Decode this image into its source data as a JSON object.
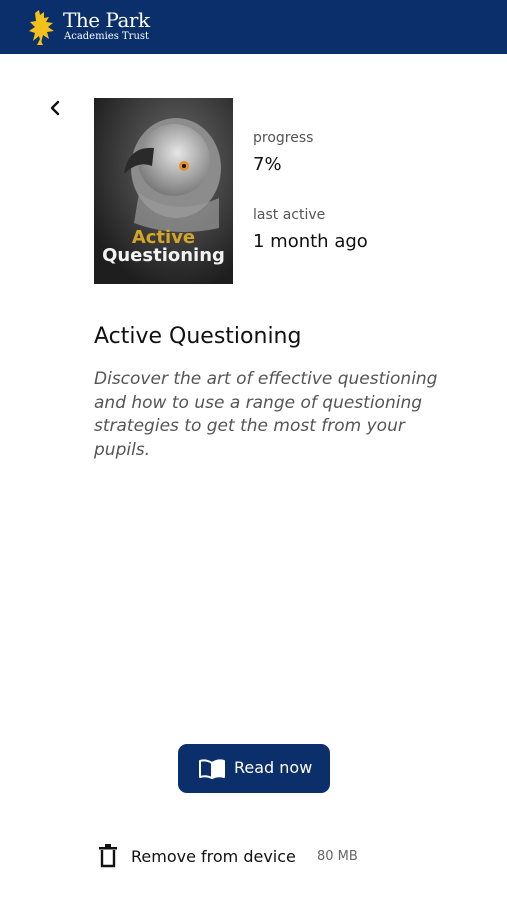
{
  "header": {
    "brand_title": "The Park",
    "brand_subtitle": "Academies Trust",
    "logo_icon": "griffin-logo-icon",
    "background": "#0b2f6b",
    "logo_color": "#f2c21a"
  },
  "nav": {
    "back_icon": "chevron-left-icon"
  },
  "course": {
    "cover_line_1": "Active",
    "cover_line_2": "Questioning",
    "progress_label": "progress",
    "progress_value": "7%",
    "last_active_label": "last active",
    "last_active_value": "1 month ago",
    "title": "Active Questioning",
    "description": "Discover the art of effective questioning and how to use a range of questioning strategies to get the most from your pupils."
  },
  "actions": {
    "read_now_label": "Read now",
    "read_icon": "open-book-icon",
    "remove_label": "Remove from device",
    "remove_icon": "trash-icon",
    "size": "80 MB"
  }
}
